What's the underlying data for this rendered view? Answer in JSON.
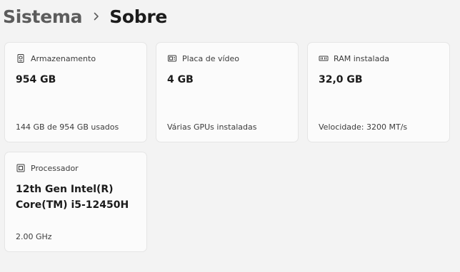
{
  "breadcrumb": {
    "parent": "Sistema",
    "separator_icon": "chevron-right-icon",
    "current": "Sobre"
  },
  "cards": {
    "storage": {
      "icon": "storage-drive-icon",
      "label": "Armazenamento",
      "value": "954 GB",
      "detail": "144 GB de 954 GB usados"
    },
    "gpu": {
      "icon": "graphics-card-icon",
      "label": "Placa de vídeo",
      "value": "4 GB",
      "detail": "Várias GPUs instaladas"
    },
    "ram": {
      "icon": "memory-icon",
      "label": "RAM instalada",
      "value": "32,0 GB",
      "detail": "Velocidade: 3200 MT/s"
    },
    "cpu": {
      "icon": "processor-icon",
      "label": "Processador",
      "value_line1": "12th Gen Intel(R)",
      "value_line2": "Core(TM) i5-12450H",
      "detail": "2.00 GHz"
    }
  },
  "colors": {
    "background": "#f3f3f3",
    "card": "#fbfbfb",
    "card_border": "#e5e5e5",
    "text_primary": "#1b1b1b",
    "text_secondary": "#3c3c3c"
  }
}
